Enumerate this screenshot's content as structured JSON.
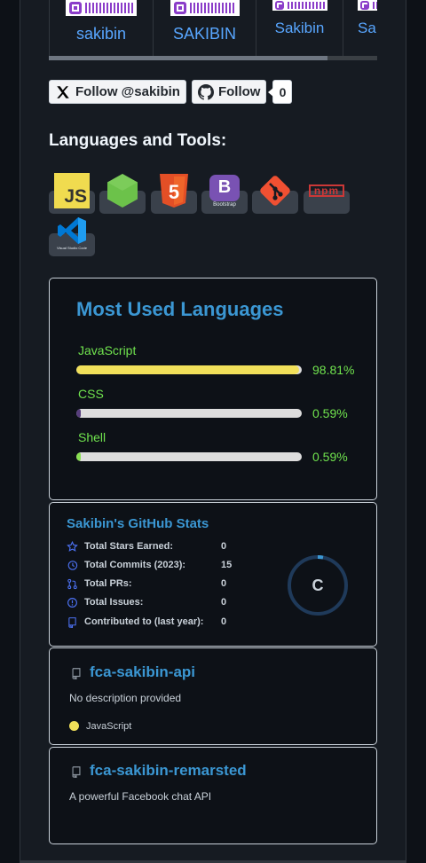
{
  "profile_cards": [
    {
      "name": "sakibin"
    },
    {
      "name": "SAKIBIN"
    },
    {
      "name": "Sakibin"
    },
    {
      "name": "Sa"
    }
  ],
  "follow": {
    "twitter_label": "Follow @sakibin",
    "github_label": "Follow",
    "github_count": "0"
  },
  "tools_section": {
    "title": "Languages and Tools:",
    "tools": [
      {
        "icon": "javascript-icon",
        "text": "JS",
        "color": "#f0db4f"
      },
      {
        "icon": "nodejs-icon",
        "color": "#6cc24a"
      },
      {
        "icon": "html5-icon",
        "text": "5",
        "color": "#e34f26"
      },
      {
        "icon": "bootstrap-icon",
        "text": "B",
        "caption": "Bootstrap",
        "color": "#7952b3"
      },
      {
        "icon": "git-icon",
        "color": "#f05032"
      },
      {
        "icon": "npm-icon",
        "text": "npm",
        "color": "#cb3837"
      },
      {
        "icon": "vscode-icon",
        "caption": "Visual Studio Code",
        "color": "#0078d4"
      }
    ]
  },
  "most_used_languages": {
    "title": "Most Used Languages",
    "languages": [
      {
        "name": "JavaScript",
        "percent": "98.81%",
        "fill": 0.9881,
        "color": "#f1e05a"
      },
      {
        "name": "CSS",
        "percent": "0.59%",
        "fill": 0.0059,
        "color": "#563d7c"
      },
      {
        "name": "Shell",
        "percent": "0.59%",
        "fill": 0.0059,
        "color": "#89e051"
      }
    ]
  },
  "github_stats": {
    "title": "Sakibin's GitHub Stats",
    "rows": [
      {
        "icon": "star-icon",
        "label": "Total Stars Earned:",
        "value": "0"
      },
      {
        "icon": "history-icon",
        "label": "Total Commits (2023):",
        "value": "15"
      },
      {
        "icon": "pull-request-icon",
        "label": "Total PRs:",
        "value": "0"
      },
      {
        "icon": "issue-icon",
        "label": "Total Issues:",
        "value": "0"
      },
      {
        "icon": "repo-icon",
        "label": "Contributed to (last year):",
        "value": "0"
      }
    ],
    "rank": "C"
  },
  "repos": [
    {
      "name": "fca-sakibin-api",
      "description": "No description provided",
      "language": "JavaScript",
      "language_color": "#f1e05a"
    },
    {
      "name": "fca-sakibin-remarsted",
      "description": "A powerful Facebook chat API"
    }
  ],
  "colors": {
    "accent": "#3b97d3",
    "lang_text": "#70e34e",
    "page_bg": "#161b22"
  }
}
